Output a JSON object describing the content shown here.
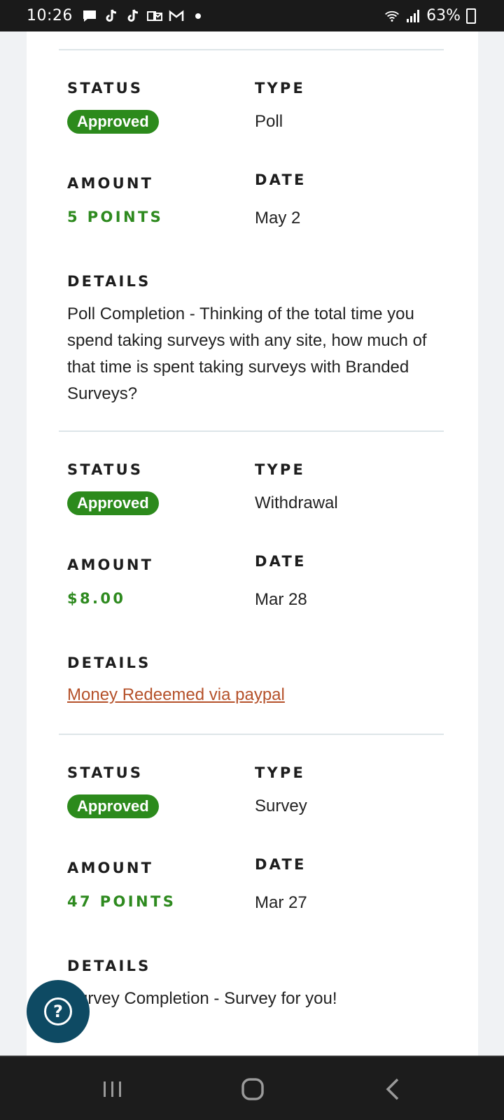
{
  "status_bar": {
    "time": "10:26",
    "notification_icons": [
      "chat-icon",
      "tiktok-icon",
      "tiktok-icon",
      "outlook-icon",
      "gmail-icon",
      "dot-icon"
    ],
    "battery": "63%"
  },
  "labels": {
    "status": "STATUS",
    "type": "TYPE",
    "amount": "AMOUNT",
    "date": "DATE",
    "details": "DETAILS"
  },
  "transactions": [
    {
      "status": "Approved",
      "type": "Poll",
      "amount": "5 POINTS",
      "date": "May 2",
      "details": "Poll Completion - Thinking of the total time you spend taking surveys with any site, how much of that time is spent taking surveys with Branded Surveys?"
    },
    {
      "status": "Approved",
      "type": "Withdrawal",
      "amount": "$8.00",
      "date": "Mar 28",
      "details_link": "Money Redeemed via paypal"
    },
    {
      "status": "Approved",
      "type": "Survey",
      "amount": "47 POINTS",
      "date": "Mar 27",
      "details": "Survey Completion - Survey for you!"
    }
  ],
  "help_button": {
    "icon": "question-icon",
    "label": "?"
  },
  "colors": {
    "badge_green": "#2c8a1c",
    "points_green": "#2e8a1f",
    "link": "#b5512a",
    "help_button": "#0e4a63"
  }
}
